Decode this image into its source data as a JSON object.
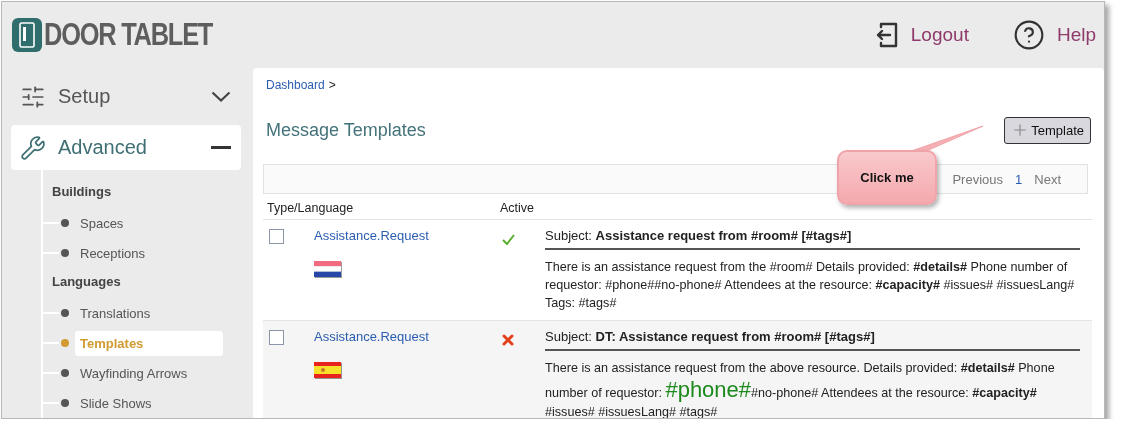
{
  "header": {
    "logo_text": "DOOR TABLET",
    "actions": [
      {
        "kind": "logout",
        "label": "Logout"
      },
      {
        "kind": "help",
        "label": "Help"
      }
    ]
  },
  "sidebar": {
    "sections": [
      {
        "kind": "setup",
        "label": "Setup",
        "expanded": false
      },
      {
        "kind": "advanced",
        "label": "Advanced",
        "expanded": true,
        "groups": [
          {
            "title": "Buildings",
            "items": [
              {
                "label": "Spaces",
                "selected": false
              },
              {
                "label": "Receptions",
                "selected": false
              }
            ]
          },
          {
            "title": "Languages",
            "items": [
              {
                "label": "Translations",
                "selected": false
              },
              {
                "label": "Templates",
                "selected": true
              },
              {
                "label": "Wayfinding Arrows",
                "selected": false
              },
              {
                "label": "Slide Shows",
                "selected": false
              }
            ]
          }
        ]
      }
    ]
  },
  "breadcrumb": {
    "link": "Dashboard",
    "separator": ">"
  },
  "page_title": "Message Templates",
  "add_button": {
    "label": "Template"
  },
  "pager": {
    "previous": "Previous",
    "page": "1",
    "next": "Next"
  },
  "columns": [
    "Type/Language",
    "Active"
  ],
  "rows": [
    {
      "checked": false,
      "type": "Assistance.Request",
      "kind": "nl",
      "active": true,
      "subject_label": "Subject:",
      "subject": "Assistance request from #room# [#tags#]",
      "body": [
        {
          "kind": "plain",
          "text": "There is an assistance request from the  #room# Details provided: "
        },
        {
          "kind": "bold",
          "text": "#details#"
        },
        {
          "kind": "plain",
          "text": " Phone number of requestor: #phone##no-phone# Attendees at the resource: "
        },
        {
          "kind": "bold",
          "text": "#capacity#"
        },
        {
          "kind": "plain",
          "text": " #issues# #issuesLang# Tags: #tags#"
        }
      ]
    },
    {
      "checked": false,
      "type": "Assistance.Request",
      "kind": "es",
      "active": false,
      "subject_label": "Subject:",
      "subject": "DT: Assistance request from #room# [#tags#]",
      "body": [
        {
          "kind": "plain",
          "text": "There is an assistance request from the above resource. Details provided: "
        },
        {
          "kind": "bold",
          "text": "#details#"
        },
        {
          "kind": "plain",
          "text": " Phone number of requestor: "
        },
        {
          "kind": "highlight",
          "text": "#phone#"
        },
        {
          "kind": "plain",
          "text": "#no-phone# Attendees at the resource: "
        },
        {
          "kind": "bold",
          "text": "#capacity#"
        },
        {
          "kind": "plain",
          "text": " #issues# #issuesLang# #tags#"
        }
      ]
    }
  ],
  "callout": {
    "text": "Click me"
  }
}
